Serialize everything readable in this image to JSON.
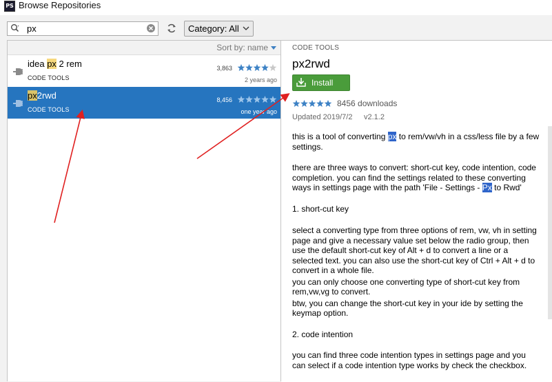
{
  "window": {
    "title": "Browse Repositories",
    "app_icon": "PS"
  },
  "toolbar": {
    "search_value": "px",
    "category_label": "Category: All"
  },
  "list": {
    "sort_label": "Sort by: name",
    "plugins": [
      {
        "name_pre": "idea ",
        "name_match": "px",
        "name_post": " 2 rem",
        "category": "CODE TOOLS",
        "downloads": "3,863",
        "rating": 4,
        "age": "2 years ago",
        "selected": false
      },
      {
        "name_pre": "",
        "name_match": "px",
        "name_post": "2rwd",
        "category": "CODE TOOLS",
        "downloads": "8,456",
        "rating": 5,
        "age": "one year ago",
        "selected": true
      }
    ]
  },
  "detail": {
    "category": "CODE TOOLS",
    "title": "px2rwd",
    "install_label": "Install",
    "rating": 5,
    "downloads": "8456 downloads",
    "updated": "Updated 2019/7/2",
    "version": "v2.1.2",
    "p1_pre": "this is a tool of converting ",
    "p1_match": "px",
    "p1_post": " to rem/vw/vh in a css/less file by a few settings.",
    "p2_pre": "there are three ways to convert: short-cut key, code intention, code completion. you can find the settings related to these converting ways in settings page with the path 'File - Settings - ",
    "p2_match": "Px",
    "p2_post": " to Rwd'",
    "h1": "1. short-cut key",
    "p3": "select a converting type from three options of rem, vw, vh in setting page and give a necessary value set below the radio group, then use the default short-cut key of Alt + d to convert a line or a selected text. you can also use the short-cut key of Ctrl + Alt + d to convert in a whole file.",
    "p4": "you can only choose one converting type of short-cut key from rem,vw,vg to convert.",
    "p5": "btw, you can change the short-cut key in your ide by setting the keymap option.",
    "h2": "2. code intention",
    "p6": "you can find three code intention types in settings page and you can select if a code intention type works by check the checkbox."
  },
  "colors": {
    "selection": "#2675bf",
    "install": "#4a9c3b",
    "star": "#3d82c5",
    "annotation": "#e02020"
  }
}
